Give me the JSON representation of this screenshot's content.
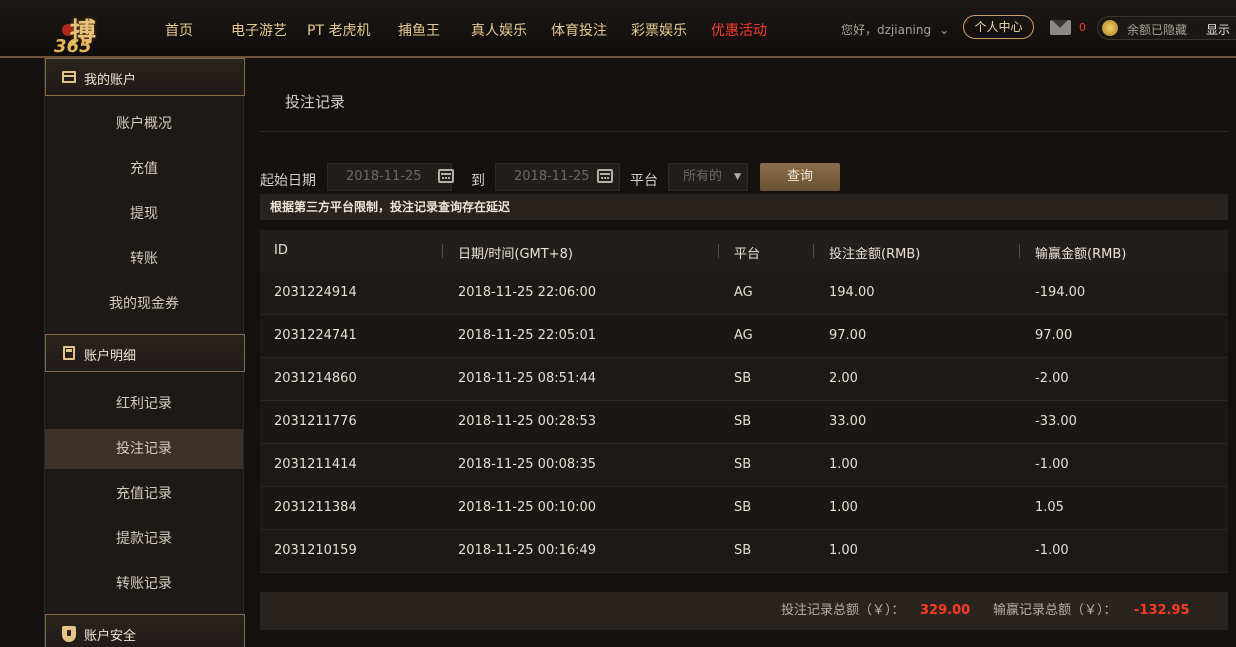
{
  "header": {
    "logo_text": "搏",
    "logo_number": "365",
    "nav": [
      {
        "label": "首页",
        "active": false
      },
      {
        "label": "电子游艺",
        "active": false
      },
      {
        "label": "PT 老虎机",
        "active": false
      },
      {
        "label": "捕鱼王",
        "active": false
      },
      {
        "label": "真人娱乐",
        "active": false
      },
      {
        "label": "体育投注",
        "active": false
      },
      {
        "label": "彩票娱乐",
        "active": false
      },
      {
        "label": "优惠活动",
        "active": true
      }
    ],
    "greeting": "您好，dzjianing",
    "personal_center": "个人中心",
    "mail_count": "0",
    "balance_hidden": "余额已隐藏",
    "balance_show": "显示"
  },
  "sidebar": {
    "sections": [
      {
        "title": "我的账户",
        "icon": "card-icon",
        "items": [
          "账户概况",
          "充值",
          "提现",
          "转账",
          "我的现金券"
        ]
      },
      {
        "title": "账户明细",
        "icon": "calculator-icon",
        "items": [
          "红利记录",
          "投注记录",
          "充值记录",
          "提款记录",
          "转账记录"
        ],
        "active_item": "投注记录"
      },
      {
        "title": "账户安全",
        "icon": "shield-icon",
        "items": []
      }
    ]
  },
  "main": {
    "title": "投注记录",
    "filter": {
      "start_label": "起始日期",
      "start_value": "2018-11-25",
      "to_label": "到",
      "end_value": "2018-11-25",
      "platform_label": "平台",
      "platform_value": "所有的",
      "query_button": "查询"
    },
    "notice": "根据第三方平台限制，投注记录查询存在延迟",
    "table": {
      "headers": [
        "ID",
        "日期/时间(GMT+8)",
        "平台",
        "投注金额(RMB)",
        "输赢金额(RMB)"
      ],
      "rows": [
        [
          "2031224914",
          "2018-11-25 22:06:00",
          "AG",
          "194.00",
          "-194.00"
        ],
        [
          "2031224741",
          "2018-11-25 22:05:01",
          "AG",
          "97.00",
          "97.00"
        ],
        [
          "2031214860",
          "2018-11-25 08:51:44",
          "SB",
          "2.00",
          "-2.00"
        ],
        [
          "2031211776",
          "2018-11-25 00:28:53",
          "SB",
          "33.00",
          "-33.00"
        ],
        [
          "2031211414",
          "2018-11-25 00:08:35",
          "SB",
          "1.00",
          "-1.00"
        ],
        [
          "2031211384",
          "2018-11-25 00:10:00",
          "SB",
          "1.00",
          "1.05"
        ],
        [
          "2031210159",
          "2018-11-25 00:16:49",
          "SB",
          "1.00",
          "-1.00"
        ]
      ]
    },
    "totals": {
      "bet_label": "投注记录总额（￥）：",
      "bet_value": "329.00",
      "win_label": "输赢记录总额（￥）：",
      "win_value": "-132.95"
    }
  },
  "colors": {
    "accent_gold": "#e6c98f",
    "active_red": "#ff3b30",
    "button_brown": "#7a5d3f"
  }
}
